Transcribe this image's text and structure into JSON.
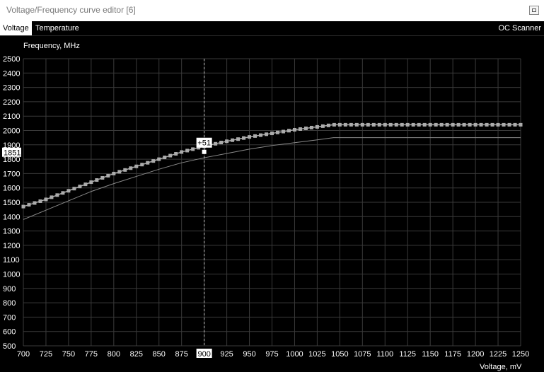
{
  "window": {
    "title": "Voltage/Frequency curve editor [6]"
  },
  "tabs": [
    {
      "label": "Voltage"
    },
    {
      "label": "Temperature"
    }
  ],
  "oc_scanner_label": "OC Scanner",
  "y_axis_label": "Frequency, MHz",
  "x_axis_label": "Voltage, mV",
  "colors": {
    "background": "#000000",
    "grid": "#3a3a3a",
    "curve_main": "#ababab",
    "curve_base": "#8a8a8a",
    "cursor": "#bdbdbd"
  },
  "chart_data": {
    "type": "line",
    "xlabel": "Voltage, mV",
    "ylabel": "Frequency, MHz",
    "xlim": [
      700,
      1250
    ],
    "ylim": [
      500,
      2500
    ],
    "grid": true,
    "x_ticks": [
      "700",
      "725",
      "750",
      "775",
      "800",
      "825",
      "850",
      "875",
      "900",
      "925",
      "950",
      "975",
      "1000",
      "1025",
      "1050",
      "1075",
      "1100",
      "1125",
      "1150",
      "1175",
      "1200",
      "1225",
      "1250"
    ],
    "y_ticks": [
      "500",
      "600",
      "700",
      "800",
      "900",
      "1000",
      "1100",
      "1200",
      "1300",
      "1400",
      "1500",
      "1600",
      "1700",
      "1800",
      "1900",
      "2000",
      "2100",
      "2200",
      "2300",
      "2400",
      "2500"
    ],
    "series": [
      {
        "x": [
          700,
          725,
          750,
          775,
          800,
          825,
          850,
          875,
          900,
          925,
          950,
          975,
          1000,
          1025,
          1043,
          1250
        ],
        "y": [
          1470,
          1520,
          1580,
          1640,
          1700,
          1750,
          1800,
          1850,
          1890,
          1925,
          1955,
          1980,
          2005,
          2025,
          2040,
          2040
        ]
      },
      {
        "x": [
          700,
          725,
          750,
          775,
          800,
          825,
          850,
          875,
          900,
          925,
          950,
          975,
          1000,
          1025,
          1043,
          1250
        ],
        "y": [
          1380,
          1445,
          1510,
          1575,
          1630,
          1680,
          1730,
          1775,
          1810,
          1840,
          1870,
          1895,
          1915,
          1935,
          1950,
          1950
        ]
      }
    ],
    "cursor": {
      "voltage": "900",
      "frequency": "1851",
      "offset": "+51"
    }
  }
}
